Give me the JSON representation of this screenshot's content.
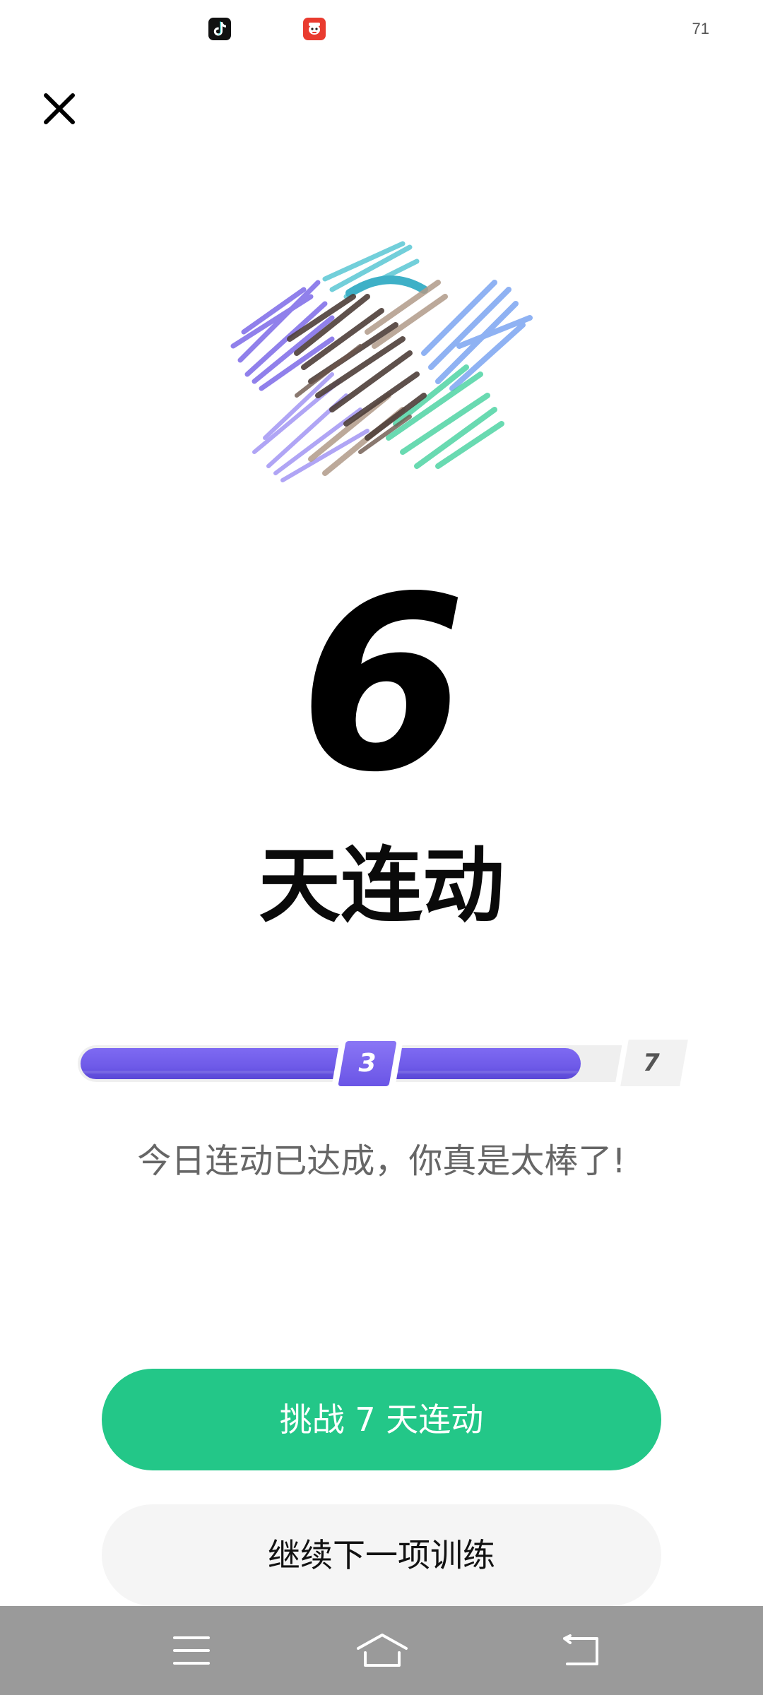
{
  "status_bar": {
    "battery_text": "71",
    "icons": [
      "tiktok-icon",
      "red-app-icon"
    ]
  },
  "header": {
    "close_icon": "close-icon"
  },
  "illustration": {
    "icon": "colorful-scribble-illustration",
    "colors": [
      "#6f5ae6",
      "#8b7bf0",
      "#3b2a24",
      "#a9907c",
      "#3ccf9b",
      "#6e9cf0",
      "#3bbccc"
    ]
  },
  "streak": {
    "number": "6",
    "label": "天连动"
  },
  "progress": {
    "current": "3",
    "goal": "7",
    "fill_fraction": 0.93,
    "fill_color": "#6e5ae8"
  },
  "message": "今日连动已达成，你真是太棒了!",
  "buttons": {
    "primary_label": "挑战 7 天连动",
    "primary_color": "#23c788",
    "secondary_label": "继续下一项训练"
  },
  "nav_bar": {
    "icons": [
      "menu-icon",
      "home-icon",
      "back-icon"
    ]
  }
}
